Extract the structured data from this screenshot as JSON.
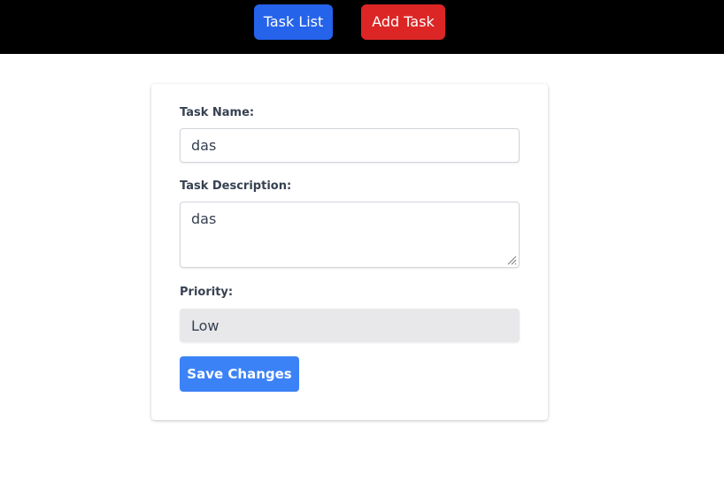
{
  "nav": {
    "task_list_label": "Task List",
    "add_task_label": "Add Task"
  },
  "form": {
    "task_name": {
      "label": "Task Name:",
      "value": "das"
    },
    "task_description": {
      "label": "Task Description:",
      "value": "das"
    },
    "priority": {
      "label": "Priority:",
      "value": "Low"
    },
    "save_label": "Save Changes"
  },
  "colors": {
    "topbar": "#000000",
    "task_list_button": "#2563eb",
    "add_task_button": "#dc2626",
    "save_button": "#3b82f6"
  }
}
